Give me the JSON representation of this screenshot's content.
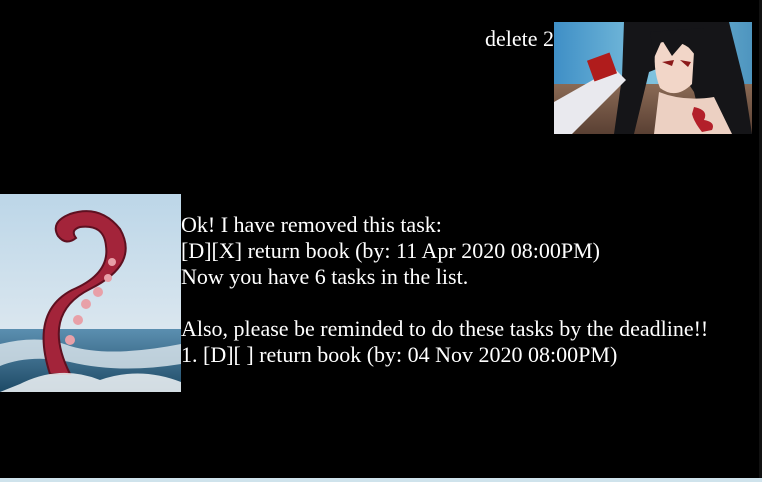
{
  "user_message": {
    "text": "delete 2",
    "avatar_icon": "user-avatar-anime-character"
  },
  "bot_message": {
    "avatar_icon": "bot-avatar-tentacle",
    "lines": [
      "Ok! I have removed this task:",
      "[D][X] return book (by: 11 Apr 2020 08:00PM)",
      "Now you have 6 tasks in the list.",
      "",
      "Also, please be reminded to do these tasks by the deadline!!",
      "1. [D][ ] return book (by: 04 Nov 2020 08:00PM)"
    ]
  },
  "colors": {
    "background": "#000000",
    "text": "#ffffff",
    "bottom_strip": "#cfe3ec"
  }
}
